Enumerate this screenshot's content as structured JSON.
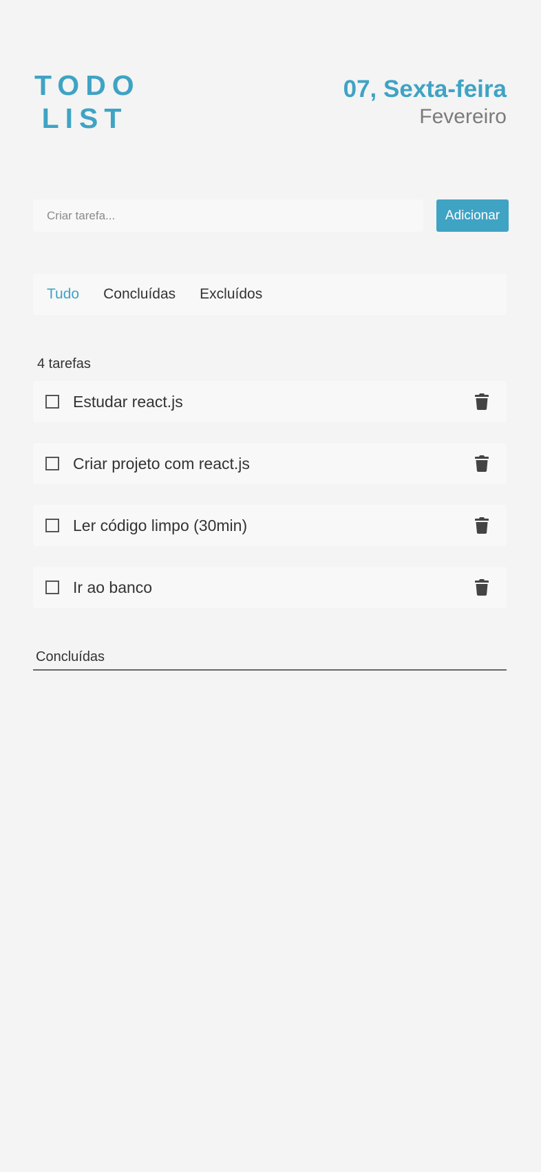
{
  "header": {
    "logo_line1": "TODO",
    "logo_line2": "LIST",
    "date_day": "07, Sexta-feira",
    "date_month": "Fevereiro"
  },
  "new_task": {
    "placeholder": "Criar tarefa...",
    "value": "",
    "add_label": "Adicionar"
  },
  "tabs": [
    {
      "label": "Tudo",
      "active": true
    },
    {
      "label": "Concluídas",
      "active": false
    },
    {
      "label": "Excluídos",
      "active": false
    }
  ],
  "task_count": "4 tarefas",
  "tasks": [
    {
      "label": "Estudar react.js",
      "checked": false,
      "icon": "trash-icon"
    },
    {
      "label": "Criar projeto com react.js",
      "checked": false,
      "icon": "trash-icon"
    },
    {
      "label": "Ler código limpo (30min)",
      "checked": false,
      "icon": "trash-icon"
    },
    {
      "label": "Ir ao banco",
      "checked": false,
      "icon": "trash-icon"
    }
  ],
  "done_section": {
    "heading": "Concluídas"
  },
  "colors": {
    "accent": "#3fa3c4",
    "background": "#f4f4f4",
    "card": "#f8f8f8",
    "text": "#333333",
    "muted": "#7b7b7b"
  }
}
